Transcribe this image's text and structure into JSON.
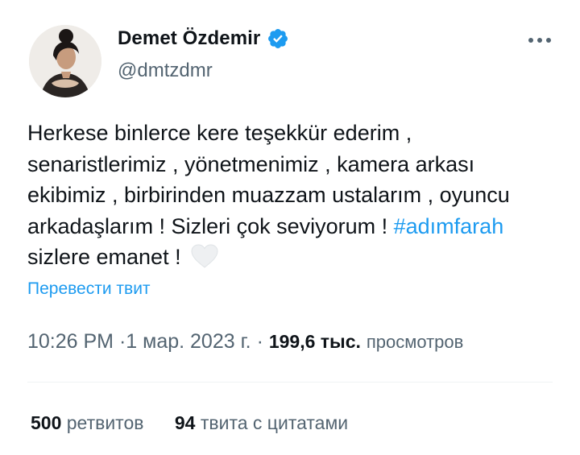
{
  "author": {
    "display_name": "Demet Özdemir",
    "handle": "@dmtzdmr",
    "verified_icon": "verified-badge-icon",
    "accent_color": "#1d9bf0"
  },
  "tweet": {
    "text_before_hashtag": "Herkese binlerce kere teşekkür ederim , senaristlerimiz , yönetmenimiz , kamera arkası ekibimiz , birbirinden muazzam ustalarım , oyuncu arkadaşlarım ! Sizleri çok seviyorum ! ",
    "hashtag": "#adımfarah",
    "text_after_hashtag": " sizlere emanet ! ",
    "emoji_icon": "white-heart-icon"
  },
  "translate_label": "Перевести твит",
  "meta": {
    "time": "10:26 PM",
    "separator": "·",
    "date": "1 мар. 2023 г.",
    "views_count": "199,6 тыс.",
    "views_label": "просмотров"
  },
  "stats": {
    "retweets_count": "500",
    "retweets_label": "ретвитов",
    "quotes_count": "94",
    "quotes_label": "твита с цитатами"
  }
}
